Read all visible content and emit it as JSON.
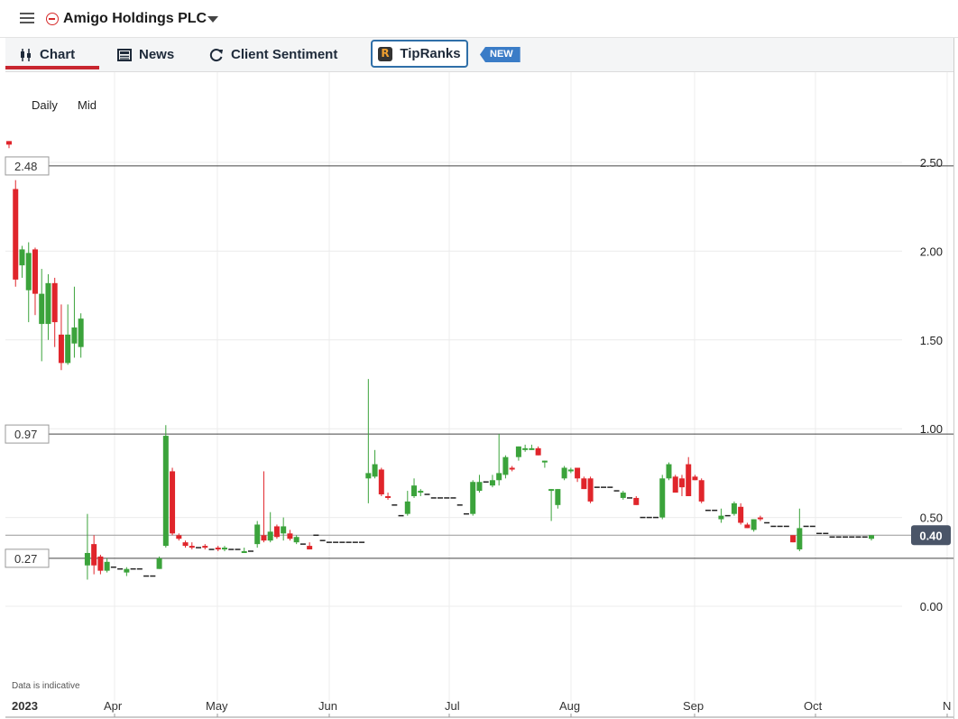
{
  "header": {
    "instrument_title": "Amigo Holdings PLC",
    "menu_icon": "hamburger-menu-icon",
    "instrument_icon": "remove-circle-icon",
    "dropdown_icon": "caret-down-icon"
  },
  "tabs": [
    {
      "label": "Chart",
      "icon": "candlestick-icon",
      "active": true
    },
    {
      "label": "News",
      "icon": "newspaper-icon"
    },
    {
      "label": "Client Sentiment",
      "icon": "refresh-icon"
    },
    {
      "label": "TipRanks",
      "icon": "tipranks-logo-icon"
    }
  ],
  "new_badge": "NEW",
  "chart_controls": {
    "interval": "Daily",
    "price_type": "Mid"
  },
  "disclaimer": "Data is indicative",
  "colors": {
    "up": "#3ba33b",
    "down": "#e0252b",
    "accent": "#c8252f",
    "price_tag": "#4a5568"
  },
  "chart_data": {
    "type": "candlestick",
    "y_axis": {
      "min": 0.0,
      "max": 2.5,
      "ticks": [
        "0.00",
        "0.50",
        "1.00",
        "1.50",
        "2.00",
        "2.50"
      ],
      "position": "right"
    },
    "x_axis": {
      "labels": [
        "2023",
        "Apr",
        "May",
        "Jun",
        "Jul",
        "Aug",
        "Sep",
        "Oct",
        "N"
      ]
    },
    "grid": true,
    "horizontal_lines": [
      {
        "label": "2.48",
        "value": 2.48
      },
      {
        "label": "0.97",
        "value": 0.97
      },
      {
        "label": "0.27",
        "value": 0.27
      }
    ],
    "current_price": {
      "label": "0.40",
      "value": 0.4
    },
    "candles": [
      {
        "x": "Mar 01",
        "o": 2.62,
        "h": 2.62,
        "l": 2.58,
        "c": 2.6
      },
      {
        "x": "Mar 02",
        "o": 2.35,
        "h": 2.4,
        "l": 1.8,
        "c": 1.84
      },
      {
        "x": "Mar 03",
        "o": 1.92,
        "h": 2.03,
        "l": 1.85,
        "c": 2.01
      },
      {
        "x": "Mar 06",
        "o": 1.78,
        "h": 2.05,
        "l": 1.6,
        "c": 1.99
      },
      {
        "x": "Mar 07",
        "o": 2.01,
        "h": 2.02,
        "l": 1.64,
        "c": 1.76
      },
      {
        "x": "Mar 08",
        "o": 1.59,
        "h": 1.9,
        "l": 1.38,
        "c": 1.76
      },
      {
        "x": "Mar 09",
        "o": 1.59,
        "h": 1.87,
        "l": 1.5,
        "c": 1.82
      },
      {
        "x": "Mar 10",
        "o": 1.82,
        "h": 1.85,
        "l": 1.46,
        "c": 1.6
      },
      {
        "x": "Mar 13",
        "o": 1.53,
        "h": 1.7,
        "l": 1.33,
        "c": 1.37
      },
      {
        "x": "Mar 14",
        "o": 1.37,
        "h": 1.7,
        "l": 1.36,
        "c": 1.53
      },
      {
        "x": "Mar 15",
        "o": 1.48,
        "h": 1.8,
        "l": 1.4,
        "c": 1.57
      },
      {
        "x": "Mar 16",
        "o": 1.46,
        "h": 1.65,
        "l": 1.4,
        "c": 1.62
      },
      {
        "x": "Mar 20",
        "o": 0.23,
        "h": 0.52,
        "l": 0.15,
        "c": 0.3
      },
      {
        "x": "Mar 21",
        "o": 0.35,
        "h": 0.4,
        "l": 0.18,
        "c": 0.23
      },
      {
        "x": "Mar 22",
        "o": 0.28,
        "h": 0.29,
        "l": 0.18,
        "c": 0.2
      },
      {
        "x": "Mar 23",
        "o": 0.2,
        "h": 0.27,
        "l": 0.19,
        "c": 0.25
      },
      {
        "x": "Mar 24",
        "o": 0.22,
        "h": 0.23,
        "l": 0.21,
        "c": 0.22
      },
      {
        "x": "Mar 27",
        "o": 0.21,
        "h": 0.22,
        "l": 0.2,
        "c": 0.21
      },
      {
        "x": "Mar 28",
        "o": 0.19,
        "h": 0.22,
        "l": 0.17,
        "c": 0.21
      },
      {
        "x": "Mar 29",
        "o": 0.2,
        "h": 0.21,
        "l": 0.2,
        "c": 0.21
      },
      {
        "x": "Mar 30",
        "o": 0.21,
        "h": 0.21,
        "l": 0.2,
        "c": 0.21
      },
      {
        "x": "Mar 31",
        "o": 0.16,
        "h": 0.17,
        "l": 0.16,
        "c": 0.17
      },
      {
        "x": "Apr 03",
        "o": 0.17,
        "h": 0.18,
        "l": 0.16,
        "c": 0.17
      },
      {
        "x": "Apr 04",
        "o": 0.21,
        "h": 0.28,
        "l": 0.21,
        "c": 0.27
      },
      {
        "x": "Apr 05",
        "o": 0.34,
        "h": 1.02,
        "l": 0.33,
        "c": 0.96
      },
      {
        "x": "Apr 06",
        "o": 0.76,
        "h": 0.78,
        "l": 0.4,
        "c": 0.41
      },
      {
        "x": "Apr 11",
        "o": 0.4,
        "h": 0.41,
        "l": 0.37,
        "c": 0.38
      },
      {
        "x": "Apr 12",
        "o": 0.36,
        "h": 0.37,
        "l": 0.33,
        "c": 0.34
      },
      {
        "x": "Apr 13",
        "o": 0.34,
        "h": 0.36,
        "l": 0.32,
        "c": 0.33
      },
      {
        "x": "Apr 14",
        "o": 0.33,
        "h": 0.34,
        "l": 0.32,
        "c": 0.33
      },
      {
        "x": "Apr 17",
        "o": 0.34,
        "h": 0.35,
        "l": 0.32,
        "c": 0.33
      },
      {
        "x": "Apr 18",
        "o": 0.32,
        "h": 0.33,
        "l": 0.31,
        "c": 0.32
      },
      {
        "x": "Apr 19",
        "o": 0.33,
        "h": 0.34,
        "l": 0.31,
        "c": 0.32
      },
      {
        "x": "Apr 20",
        "o": 0.32,
        "h": 0.34,
        "l": 0.31,
        "c": 0.33
      },
      {
        "x": "Apr 21",
        "o": 0.32,
        "h": 0.33,
        "l": 0.31,
        "c": 0.32
      },
      {
        "x": "Apr 24",
        "o": 0.32,
        "h": 0.33,
        "l": 0.31,
        "c": 0.32
      },
      {
        "x": "Apr 25",
        "o": 0.31,
        "h": 0.33,
        "l": 0.3,
        "c": 0.31
      },
      {
        "x": "Apr 26",
        "o": 0.3,
        "h": 0.31,
        "l": 0.3,
        "c": 0.31
      },
      {
        "x": "Apr 27",
        "o": 0.35,
        "h": 0.48,
        "l": 0.33,
        "c": 0.46
      },
      {
        "x": "Apr 28",
        "o": 0.4,
        "h": 0.76,
        "l": 0.36,
        "c": 0.37
      },
      {
        "x": "May 02",
        "o": 0.37,
        "h": 0.53,
        "l": 0.36,
        "c": 0.42
      },
      {
        "x": "May 03",
        "o": 0.45,
        "h": 0.46,
        "l": 0.38,
        "c": 0.39
      },
      {
        "x": "May 04",
        "o": 0.41,
        "h": 0.5,
        "l": 0.37,
        "c": 0.45
      },
      {
        "x": "May 05",
        "o": 0.41,
        "h": 0.43,
        "l": 0.37,
        "c": 0.38
      },
      {
        "x": "May 09",
        "o": 0.36,
        "h": 0.4,
        "l": 0.35,
        "c": 0.39
      },
      {
        "x": "May 10",
        "o": 0.36,
        "h": 0.37,
        "l": 0.35,
        "c": 0.35
      },
      {
        "x": "May 11",
        "o": 0.34,
        "h": 0.36,
        "l": 0.32,
        "c": 0.32
      },
      {
        "x": "May 12",
        "o": 0.4,
        "h": 0.4,
        "l": 0.39,
        "c": 0.4
      },
      {
        "x": "May 15",
        "o": 0.38,
        "h": 0.38,
        "l": 0.37,
        "c": 0.37
      },
      {
        "x": "May 16",
        "o": 0.36,
        "h": 0.37,
        "l": 0.36,
        "c": 0.36
      },
      {
        "x": "May 17",
        "o": 0.36,
        "h": 0.37,
        "l": 0.36,
        "c": 0.36
      },
      {
        "x": "May 18",
        "o": 0.36,
        "h": 0.37,
        "l": 0.36,
        "c": 0.36
      },
      {
        "x": "May 19",
        "o": 0.36,
        "h": 0.37,
        "l": 0.36,
        "c": 0.36
      },
      {
        "x": "May 22",
        "o": 0.36,
        "h": 0.36,
        "l": 0.36,
        "c": 0.36
      },
      {
        "x": "May 23",
        "o": 0.36,
        "h": 0.36,
        "l": 0.36,
        "c": 0.36
      },
      {
        "x": "May 24",
        "o": 0.72,
        "h": 1.28,
        "l": 0.58,
        "c": 0.75
      },
      {
        "x": "May 25",
        "o": 0.73,
        "h": 0.88,
        "l": 0.72,
        "c": 0.8
      },
      {
        "x": "May 26",
        "o": 0.77,
        "h": 0.78,
        "l": 0.62,
        "c": 0.63
      },
      {
        "x": "May 30",
        "o": 0.62,
        "h": 0.64,
        "l": 0.6,
        "c": 0.61
      },
      {
        "x": "May 31",
        "o": 0.57,
        "h": 0.58,
        "l": 0.56,
        "c": 0.57
      },
      {
        "x": "Jun 01",
        "o": 0.51,
        "h": 0.52,
        "l": 0.5,
        "c": 0.51
      },
      {
        "x": "Jun 02",
        "o": 0.52,
        "h": 0.65,
        "l": 0.51,
        "c": 0.59
      },
      {
        "x": "Jun 05",
        "o": 0.62,
        "h": 0.72,
        "l": 0.61,
        "c": 0.68
      },
      {
        "x": "Jun 06",
        "o": 0.64,
        "h": 0.66,
        "l": 0.62,
        "c": 0.65
      },
      {
        "x": "Jun 07",
        "o": 0.63,
        "h": 0.64,
        "l": 0.62,
        "c": 0.63
      },
      {
        "x": "Jun 08",
        "o": 0.61,
        "h": 0.62,
        "l": 0.6,
        "c": 0.61
      },
      {
        "x": "Jun 09",
        "o": 0.61,
        "h": 0.61,
        "l": 0.6,
        "c": 0.61
      },
      {
        "x": "Jun 12",
        "o": 0.61,
        "h": 0.61,
        "l": 0.6,
        "c": 0.61
      },
      {
        "x": "Jun 13",
        "o": 0.61,
        "h": 0.61,
        "l": 0.6,
        "c": 0.61
      },
      {
        "x": "Jun 14",
        "o": 0.57,
        "h": 0.58,
        "l": 0.56,
        "c": 0.57
      },
      {
        "x": "Jun 15",
        "o": 0.52,
        "h": 0.53,
        "l": 0.52,
        "c": 0.52
      },
      {
        "x": "Jun 16",
        "o": 0.52,
        "h": 0.71,
        "l": 0.51,
        "c": 0.7
      },
      {
        "x": "Jun 19",
        "o": 0.65,
        "h": 0.74,
        "l": 0.64,
        "c": 0.7
      },
      {
        "x": "Jun 20",
        "o": 0.7,
        "h": 0.71,
        "l": 0.69,
        "c": 0.7
      },
      {
        "x": "Jun 21",
        "o": 0.68,
        "h": 0.74,
        "l": 0.67,
        "c": 0.71
      },
      {
        "x": "Jun 22",
        "o": 0.71,
        "h": 0.97,
        "l": 0.68,
        "c": 0.75
      },
      {
        "x": "Jun 23",
        "o": 0.74,
        "h": 0.85,
        "l": 0.72,
        "c": 0.84
      },
      {
        "x": "Jun 26",
        "o": 0.78,
        "h": 0.79,
        "l": 0.76,
        "c": 0.77
      },
      {
        "x": "Jun 27",
        "o": 0.84,
        "h": 0.9,
        "l": 0.82,
        "c": 0.9
      },
      {
        "x": "Jun 28",
        "o": 0.89,
        "h": 0.91,
        "l": 0.87,
        "c": 0.89
      },
      {
        "x": "Jun 29",
        "o": 0.89,
        "h": 0.91,
        "l": 0.88,
        "c": 0.89
      },
      {
        "x": "Jun 30",
        "o": 0.89,
        "h": 0.9,
        "l": 0.85,
        "c": 0.85
      },
      {
        "x": "Jul 03",
        "o": 0.82,
        "h": 0.82,
        "l": 0.78,
        "c": 0.82
      },
      {
        "x": "Jul 04",
        "o": 0.65,
        "h": 0.66,
        "l": 0.48,
        "c": 0.66
      },
      {
        "x": "Jul 05",
        "o": 0.57,
        "h": 0.66,
        "l": 0.55,
        "c": 0.66
      },
      {
        "x": "Jul 06",
        "o": 0.72,
        "h": 0.79,
        "l": 0.71,
        "c": 0.78
      },
      {
        "x": "Jul 07",
        "o": 0.76,
        "h": 0.78,
        "l": 0.75,
        "c": 0.77
      },
      {
        "x": "Jul 10",
        "o": 0.78,
        "h": 0.78,
        "l": 0.7,
        "c": 0.72
      },
      {
        "x": "Jul 11",
        "o": 0.72,
        "h": 0.73,
        "l": 0.66,
        "c": 0.66
      },
      {
        "x": "Jul 12",
        "o": 0.72,
        "h": 0.73,
        "l": 0.58,
        "c": 0.59
      },
      {
        "x": "Jul 13",
        "o": 0.67,
        "h": 0.68,
        "l": 0.66,
        "c": 0.67
      },
      {
        "x": "Jul 14",
        "o": 0.67,
        "h": 0.68,
        "l": 0.66,
        "c": 0.67
      },
      {
        "x": "Jul 17",
        "o": 0.67,
        "h": 0.68,
        "l": 0.66,
        "c": 0.67
      },
      {
        "x": "Jul 18",
        "o": 0.65,
        "h": 0.66,
        "l": 0.64,
        "c": 0.65
      },
      {
        "x": "Jul 19",
        "o": 0.61,
        "h": 0.65,
        "l": 0.6,
        "c": 0.64
      },
      {
        "x": "Jul 20",
        "o": 0.61,
        "h": 0.62,
        "l": 0.6,
        "c": 0.61
      },
      {
        "x": "Jul 21",
        "o": 0.61,
        "h": 0.62,
        "l": 0.57,
        "c": 0.57
      },
      {
        "x": "Jul 24",
        "o": 0.5,
        "h": 0.51,
        "l": 0.49,
        "c": 0.5
      },
      {
        "x": "Jul 25",
        "o": 0.5,
        "h": 0.51,
        "l": 0.49,
        "c": 0.5
      },
      {
        "x": "Jul 26",
        "o": 0.5,
        "h": 0.51,
        "l": 0.49,
        "c": 0.5
      },
      {
        "x": "Jul 27",
        "o": 0.5,
        "h": 0.74,
        "l": 0.49,
        "c": 0.72
      },
      {
        "x": "Jul 28",
        "o": 0.72,
        "h": 0.81,
        "l": 0.71,
        "c": 0.8
      },
      {
        "x": "Jul 31",
        "o": 0.73,
        "h": 0.74,
        "l": 0.64,
        "c": 0.64
      },
      {
        "x": "Aug 01",
        "o": 0.72,
        "h": 0.74,
        "l": 0.62,
        "c": 0.67
      },
      {
        "x": "Aug 02",
        "o": 0.8,
        "h": 0.84,
        "l": 0.62,
        "c": 0.62
      },
      {
        "x": "Aug 03",
        "o": 0.73,
        "h": 0.74,
        "l": 0.71,
        "c": 0.71
      },
      {
        "x": "Aug 04",
        "o": 0.71,
        "h": 0.72,
        "l": 0.58,
        "c": 0.59
      },
      {
        "x": "Aug 07",
        "o": 0.54,
        "h": 0.55,
        "l": 0.53,
        "c": 0.54
      },
      {
        "x": "Aug 08",
        "o": 0.54,
        "h": 0.55,
        "l": 0.53,
        "c": 0.54
      },
      {
        "x": "Aug 09",
        "o": 0.49,
        "h": 0.55,
        "l": 0.47,
        "c": 0.51
      },
      {
        "x": "Aug 10",
        "o": 0.51,
        "h": 0.52,
        "l": 0.5,
        "c": 0.51
      },
      {
        "x": "Aug 11",
        "o": 0.52,
        "h": 0.59,
        "l": 0.51,
        "c": 0.58
      },
      {
        "x": "Aug 14",
        "o": 0.56,
        "h": 0.58,
        "l": 0.46,
        "c": 0.47
      },
      {
        "x": "Aug 15",
        "o": 0.46,
        "h": 0.47,
        "l": 0.44,
        "c": 0.44
      },
      {
        "x": "Aug 16",
        "o": 0.43,
        "h": 0.49,
        "l": 0.42,
        "c": 0.49
      },
      {
        "x": "Aug 17",
        "o": 0.5,
        "h": 0.51,
        "l": 0.48,
        "c": 0.49
      },
      {
        "x": "Aug 18",
        "o": 0.47,
        "h": 0.48,
        "l": 0.46,
        "c": 0.47
      },
      {
        "x": "Aug 21",
        "o": 0.45,
        "h": 0.46,
        "l": 0.44,
        "c": 0.45
      },
      {
        "x": "Aug 22",
        "o": 0.45,
        "h": 0.46,
        "l": 0.44,
        "c": 0.45
      },
      {
        "x": "Aug 23",
        "o": 0.45,
        "h": 0.46,
        "l": 0.44,
        "c": 0.45
      },
      {
        "x": "Aug 24",
        "o": 0.4,
        "h": 0.4,
        "l": 0.36,
        "c": 0.36
      },
      {
        "x": "Aug 25",
        "o": 0.32,
        "h": 0.55,
        "l": 0.31,
        "c": 0.44
      },
      {
        "x": "Aug 29",
        "o": 0.45,
        "h": 0.46,
        "l": 0.44,
        "c": 0.45
      },
      {
        "x": "Aug 30",
        "o": 0.45,
        "h": 0.46,
        "l": 0.44,
        "c": 0.45
      },
      {
        "x": "Aug 31",
        "o": 0.41,
        "h": 0.41,
        "l": 0.4,
        "c": 0.41
      },
      {
        "x": "Sep 01",
        "o": 0.41,
        "h": 0.41,
        "l": 0.4,
        "c": 0.41
      },
      {
        "x": "Sep 04",
        "o": 0.4,
        "h": 0.4,
        "l": 0.39,
        "c": 0.39
      },
      {
        "x": "Sep 05",
        "o": 0.39,
        "h": 0.39,
        "l": 0.38,
        "c": 0.39
      },
      {
        "x": "Sep 06",
        "o": 0.39,
        "h": 0.39,
        "l": 0.38,
        "c": 0.39
      },
      {
        "x": "Sep 07",
        "o": 0.39,
        "h": 0.39,
        "l": 0.38,
        "c": 0.39
      },
      {
        "x": "Sep 08",
        "o": 0.39,
        "h": 0.39,
        "l": 0.38,
        "c": 0.39
      },
      {
        "x": "Sep 11",
        "o": 0.39,
        "h": 0.39,
        "l": 0.38,
        "c": 0.39
      },
      {
        "x": "Sep 12",
        "o": 0.38,
        "h": 0.4,
        "l": 0.37,
        "c": 0.4
      }
    ]
  }
}
